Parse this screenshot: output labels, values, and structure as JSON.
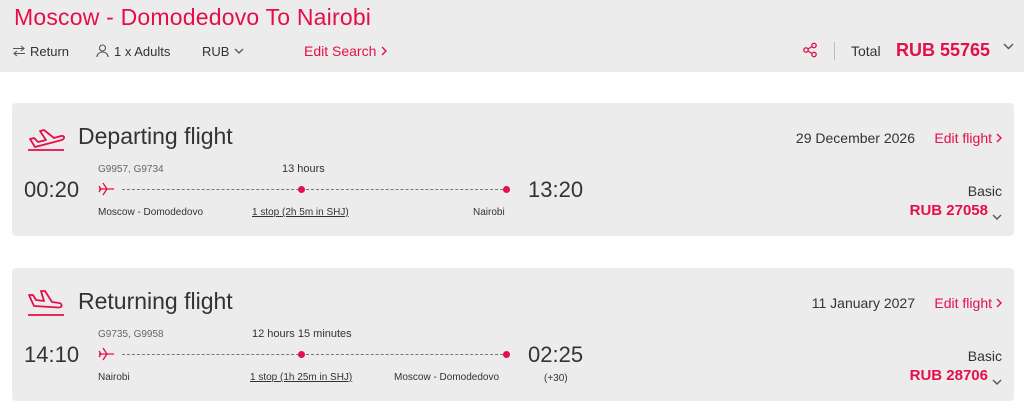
{
  "header": {
    "title": "Moscow - Domodedovo To Nairobi",
    "trip_type": "Return",
    "passengers": "1 x Adults",
    "currency": "RUB",
    "edit_search": "Edit Search",
    "total_label": "Total",
    "total_value": "RUB 55765"
  },
  "departing": {
    "title": "Departing flight",
    "date": "29 December 2026",
    "edit_label": "Edit flight",
    "flight_numbers": "G9957, G9734",
    "duration": "13 hours",
    "depart_time": "00:20",
    "arrive_time": "13:20",
    "origin": "Moscow - Domodedovo",
    "stop": "1 stop (2h 5m in SHJ)",
    "destination": "Nairobi",
    "fare_class": "Basic",
    "price": "RUB 27058"
  },
  "returning": {
    "title": "Returning flight",
    "date": "11 January 2027",
    "edit_label": "Edit flight",
    "flight_numbers": "G9735, G9958",
    "duration": "12 hours 15 minutes",
    "depart_time": "14:10",
    "arrive_time": "02:25",
    "day_offset": "(+30)",
    "origin": "Nairobi",
    "stop": "1 stop (1h 25m in SHJ)",
    "destination": "Moscow - Domodedovo",
    "fare_class": "Basic",
    "price": "RUB 28706"
  },
  "colors": {
    "accent": "#e60e4a",
    "panel": "#ececec",
    "text": "#333333"
  }
}
